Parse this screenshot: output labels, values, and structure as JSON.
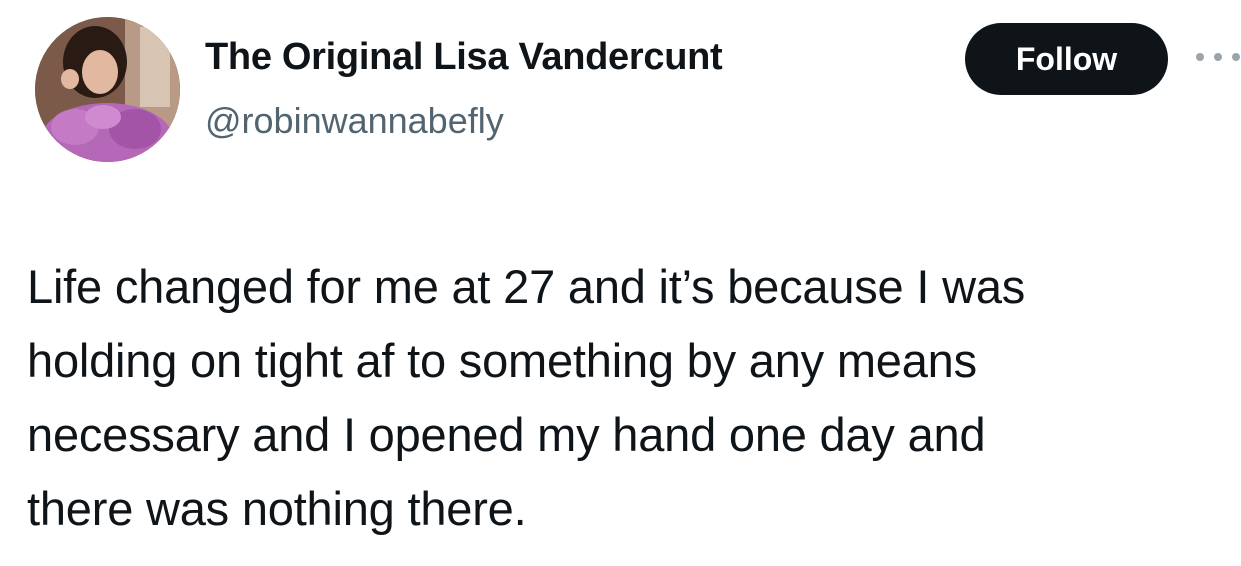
{
  "author": {
    "display_name": "The Original Lisa Vandercunt",
    "handle": "@robinwannabefly"
  },
  "actions": {
    "follow_label": "Follow",
    "more_icon": "more-horizontal-icon"
  },
  "tweet": {
    "lines": [
      "Life changed for me at 27 and it’s because I was",
      "holding on tight af to something by any means",
      "necessary and I opened my hand one day and",
      "there was nothing there."
    ]
  },
  "colors": {
    "text": "#0f1419",
    "secondary_text": "#536471",
    "button_bg": "#0f1419",
    "button_text": "#ffffff",
    "background": "#ffffff"
  }
}
